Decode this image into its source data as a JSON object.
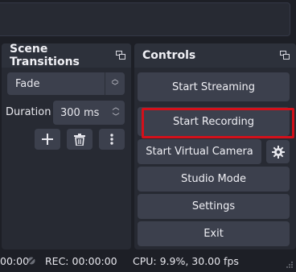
{
  "transitions": {
    "title": "Scene Transitions",
    "selected": "Fade",
    "duration_label": "Duration",
    "duration_value": "300 ms"
  },
  "controls": {
    "title": "Controls",
    "start_streaming": "Start Streaming",
    "start_recording": "Start Recording",
    "start_virtual_camera": "Start Virtual Camera",
    "studio_mode": "Studio Mode",
    "settings": "Settings",
    "exit": "Exit"
  },
  "status": {
    "stream_time": "00:00",
    "rec_label": "REC: 00:00:00",
    "cpu": "CPU: 9.9%, 30.00 fps"
  },
  "colors": {
    "highlight": "#d4101a",
    "button": "#3c404d",
    "dock": "#272a33"
  }
}
